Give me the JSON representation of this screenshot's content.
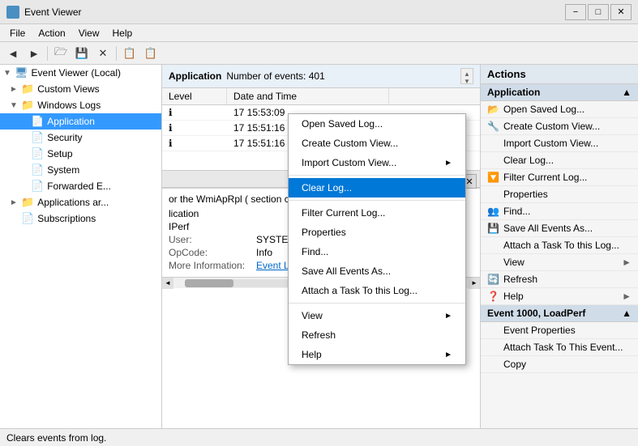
{
  "window": {
    "title": "Event Viewer",
    "controls": [
      "−",
      "□",
      "✕"
    ]
  },
  "menubar": {
    "items": [
      "File",
      "Action",
      "View",
      "Help"
    ]
  },
  "toolbar": {
    "buttons": [
      "◄",
      "►",
      "🗁",
      "💾",
      "✕",
      "📋",
      "📋"
    ]
  },
  "tree": {
    "root": {
      "label": "Event Viewer (Local)",
      "expanded": true
    },
    "items": [
      {
        "label": "Custom Views",
        "level": 1,
        "expanded": false,
        "icon": "📁"
      },
      {
        "label": "Windows Logs",
        "level": 1,
        "expanded": true,
        "icon": "📁"
      },
      {
        "label": "Application",
        "level": 2,
        "selected": true,
        "icon": "📄"
      },
      {
        "label": "Security",
        "level": 2,
        "icon": "📄"
      },
      {
        "label": "Setup",
        "level": 2,
        "icon": "📄"
      },
      {
        "label": "System",
        "level": 2,
        "icon": "📄"
      },
      {
        "label": "Forwarded E...",
        "level": 2,
        "icon": "📄"
      },
      {
        "label": "Applications ar...",
        "level": 1,
        "icon": "📁"
      },
      {
        "label": "Subscriptions",
        "level": 1,
        "icon": "📄"
      }
    ]
  },
  "main_header": {
    "title": "Application",
    "count_label": "Number of events: 401"
  },
  "table": {
    "columns": [
      "Level",
      "Date and Time"
    ],
    "rows": [
      {
        "level": "",
        "date": "17 15:53:09",
        "flag": ""
      },
      {
        "level": "",
        "date": "17 15:51:16",
        "flag": "↓"
      },
      {
        "level": "",
        "date": "17 15:51:16",
        "flag": "↓"
      }
    ]
  },
  "detail": {
    "description_text": "or the WmiApRpl ( section contains th",
    "source_label": "",
    "source_value": "lication",
    "taskcat_value": "IPerf",
    "user_label": "User:",
    "user_value": "SYSTEM",
    "opcode_label": "OpCode:",
    "opcode_value": "Info",
    "more_info_label": "More Information:",
    "more_info_link": "Event Log Online Help"
  },
  "context_menu": {
    "items": [
      {
        "label": "Open Saved Log...",
        "highlighted": false,
        "has_arrow": false
      },
      {
        "label": "Create Custom View...",
        "highlighted": false,
        "has_arrow": false
      },
      {
        "label": "Import Custom View...",
        "highlighted": false,
        "has_arrow": false,
        "separator_after": true
      },
      {
        "label": "Clear Log...",
        "highlighted": true,
        "has_arrow": false
      },
      {
        "label": "Filter Current Log...",
        "highlighted": false,
        "has_arrow": false
      },
      {
        "label": "Properties",
        "highlighted": false,
        "has_arrow": false
      },
      {
        "label": "Find...",
        "highlighted": false,
        "has_arrow": false
      },
      {
        "label": "Save All Events As...",
        "highlighted": false,
        "has_arrow": false
      },
      {
        "label": "Attach a Task To this Log...",
        "highlighted": false,
        "has_arrow": false,
        "separator_after": true
      },
      {
        "label": "View",
        "highlighted": false,
        "has_arrow": true
      },
      {
        "label": "Refresh",
        "highlighted": false,
        "has_arrow": false
      },
      {
        "label": "Help",
        "highlighted": false,
        "has_arrow": true
      }
    ]
  },
  "actions_panel": {
    "header": "Actions",
    "sections": [
      {
        "title": "Application",
        "items": [
          {
            "label": "Open Saved Log...",
            "icon": "📂"
          },
          {
            "label": "Create Custom View...",
            "icon": "🔧"
          },
          {
            "label": "Import Custom View...",
            "icon": ""
          },
          {
            "label": "Clear Log...",
            "icon": ""
          },
          {
            "label": "Filter Current Log...",
            "icon": "🔽"
          },
          {
            "label": "Properties",
            "icon": ""
          },
          {
            "label": "Find...",
            "icon": "👥"
          },
          {
            "label": "Save All Events As...",
            "icon": "💾"
          },
          {
            "label": "Attach a Task To this Log...",
            "icon": ""
          },
          {
            "label": "View",
            "icon": "",
            "has_arrow": true
          },
          {
            "label": "Refresh",
            "icon": "🔄"
          },
          {
            "label": "Help",
            "icon": "❓",
            "has_arrow": true
          }
        ]
      },
      {
        "title": "Event 1000, LoadPerf",
        "items": [
          {
            "label": "Event Properties",
            "icon": ""
          },
          {
            "label": "Attach Task To This Event...",
            "icon": ""
          },
          {
            "label": "Copy",
            "icon": ""
          }
        ]
      }
    ]
  },
  "status_bar": {
    "text": "Clears events from log."
  },
  "scrollbar": {
    "horiz_left": "◄",
    "horiz_right": "►"
  }
}
